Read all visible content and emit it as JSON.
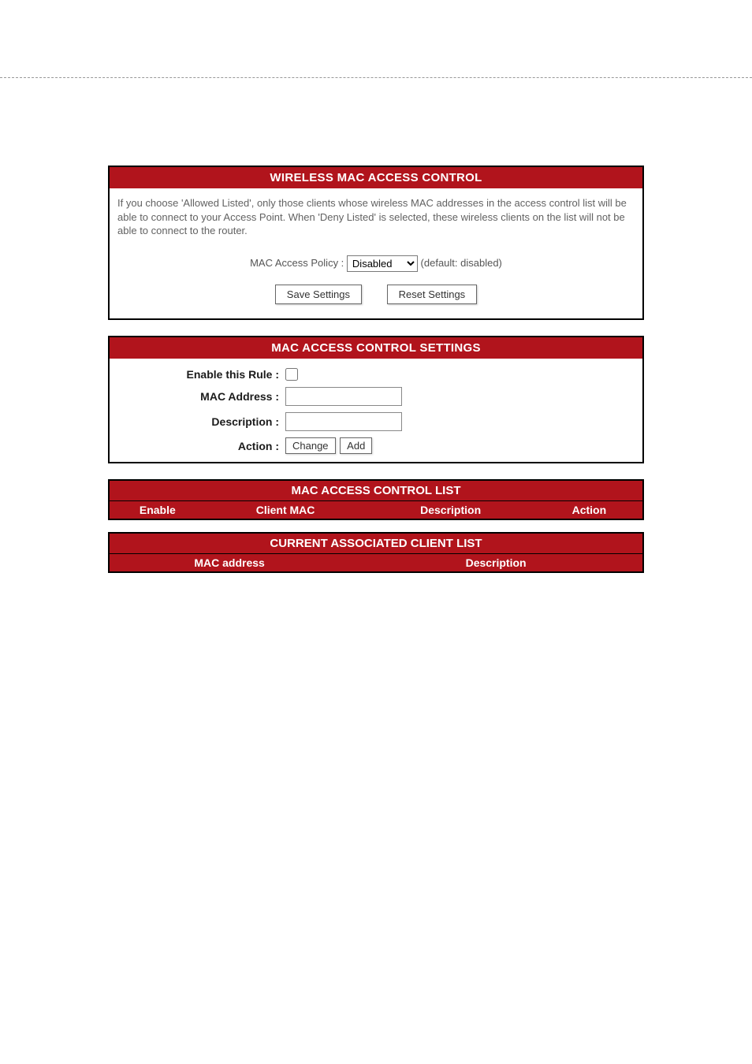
{
  "section1": {
    "title": "WIRELESS MAC ACCESS CONTROL",
    "description": "If you choose 'Allowed Listed', only those clients whose wireless MAC addresses in the access control list will be able to connect to your Access Point. When 'Deny Listed' is selected, these wireless clients on the list will not be able to connect to the router.",
    "policy_label": "MAC Access Policy :",
    "policy_value": "Disabled",
    "policy_default_hint": "(default: disabled)",
    "save_btn": "Save Settings",
    "reset_btn": "Reset Settings"
  },
  "section2": {
    "title": "MAC ACCESS CONTROL SETTINGS",
    "enable_label": "Enable this Rule :",
    "mac_label": "MAC Address :",
    "desc_label": "Description :",
    "action_label": "Action :",
    "change_btn": "Change",
    "add_btn": "Add"
  },
  "list1": {
    "title": "MAC ACCESS CONTROL LIST",
    "col_enable": "Enable",
    "col_mac": "Client MAC",
    "col_desc": "Description",
    "col_action": "Action"
  },
  "list2": {
    "title": "CURRENT ASSOCIATED CLIENT LIST",
    "col_mac": "MAC address",
    "col_desc": "Description"
  }
}
